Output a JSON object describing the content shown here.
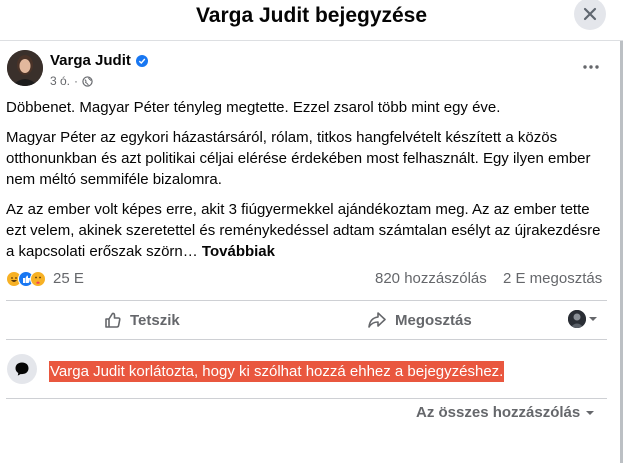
{
  "header": {
    "title": "Varga Judit bejegyzése",
    "close_icon": "close-icon"
  },
  "post": {
    "author": "Varga Judit",
    "time": "3 ó.",
    "paragraphs": [
      "Döbbenet. Magyar Péter tényleg megtette. Ezzel zsarol több mint egy éve.",
      "Magyar Péter az egykori házastársáról, rólam, titkos hangfelvételt készített a közös otthonunkban és azt politikai céljai elérése érdekében most felhasznált. Egy ilyen ember nem méltó semmiféle bizalomra.",
      "Az az ember volt képes erre, akit 3 fiúgyermekkel ajándékoztam meg. Az az ember tette ezt velem, akinek szeretettel és reménykedéssel adtam számtalan esélyt az újrakezdésre a kapcsolati erőszak szörn…"
    ],
    "see_more": "Továbbiak"
  },
  "stats": {
    "reaction_count": "25 E",
    "comments": "820 hozzászólás",
    "shares": "2 E megosztás"
  },
  "actions": {
    "like": "Tetszik",
    "share": "Megosztás"
  },
  "notice": "Varga Judit korlátozta, hogy ki szólhat hozzá ehhez a bejegyzéshez.",
  "comments_filter": "Az összes hozzászólás",
  "colors": {
    "accent": "#1877f2",
    "notice_bg": "#e9573f",
    "secondary_text": "#65676b"
  }
}
